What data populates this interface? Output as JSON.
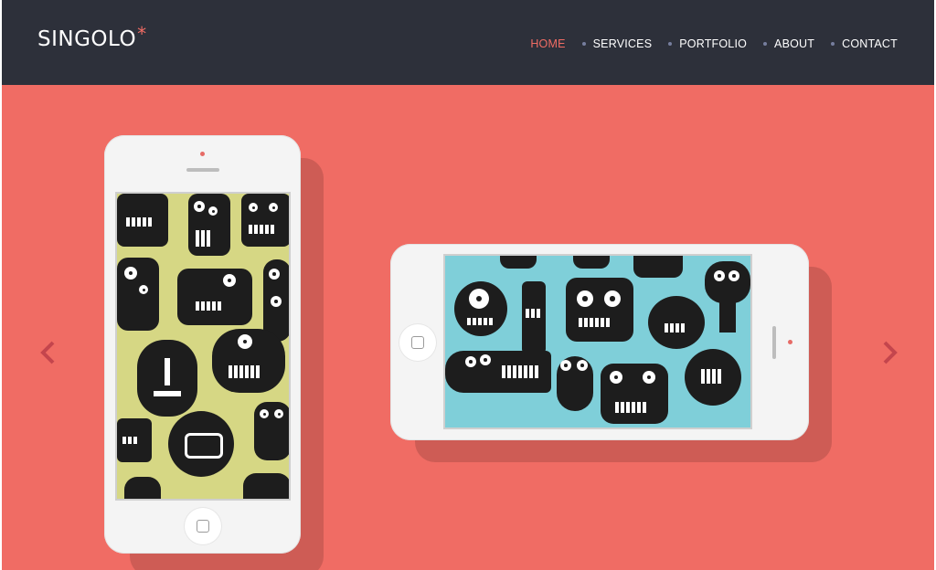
{
  "header": {
    "logo_text": "SINGOLO",
    "logo_mark": "*",
    "nav": [
      {
        "label": "HOME",
        "active": true
      },
      {
        "label": "SERVICES",
        "active": false
      },
      {
        "label": "PORTFOLIO",
        "active": false
      },
      {
        "label": "ABOUT",
        "active": false
      },
      {
        "label": "CONTACT",
        "active": false
      }
    ]
  },
  "slider": {
    "prev_icon": "chevron-left-icon",
    "next_icon": "chevron-right-icon",
    "phones": [
      {
        "orientation": "vertical",
        "wallpaper": "yellow-monsters"
      },
      {
        "orientation": "horizontal",
        "wallpaper": "blue-monsters"
      }
    ]
  },
  "colors": {
    "header_bg": "#2d303a",
    "accent": "#f06c64",
    "slide_bg": "#f06c64",
    "nav_dot": "#767e9e"
  }
}
